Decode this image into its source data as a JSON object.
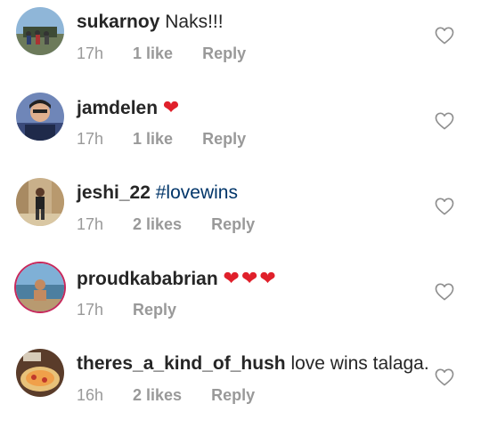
{
  "comments": [
    {
      "username": "sukarnoy",
      "text": "Naks!!!",
      "hashtag": "",
      "hearts": "",
      "time": "17h",
      "likes": "1 like",
      "reply": "Reply"
    },
    {
      "username": "jamdelen",
      "text": "",
      "hashtag": "",
      "hearts": "❤",
      "time": "17h",
      "likes": "1 like",
      "reply": "Reply"
    },
    {
      "username": "jeshi_22",
      "text": "",
      "hashtag": "#lovewins",
      "hearts": "",
      "time": "17h",
      "likes": "2 likes",
      "reply": "Reply"
    },
    {
      "username": "proudkababrian",
      "text": "",
      "hashtag": "",
      "hearts": "❤❤❤",
      "time": "17h",
      "likes": "",
      "reply": "Reply"
    },
    {
      "username": "theres_a_kind_of_hush",
      "text": "love wins talaga.",
      "hashtag": "",
      "hearts": "",
      "time": "16h",
      "likes": "2 likes",
      "reply": "Reply"
    }
  ],
  "icons": {
    "like": "heart-outline-icon"
  },
  "colors": {
    "username": "#262626",
    "meta": "#999999",
    "hashtag": "#003569",
    "heart_emoji": "#e0202b",
    "story_ring": "#c8285b"
  }
}
